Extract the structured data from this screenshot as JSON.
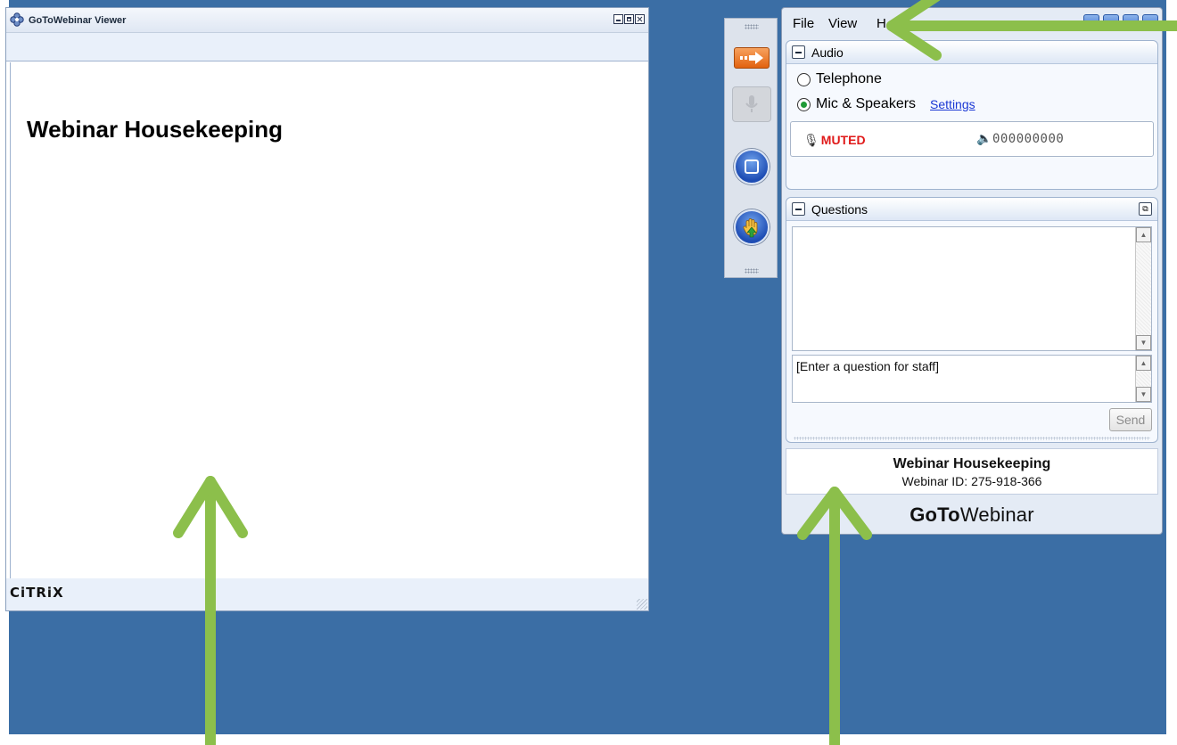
{
  "viewer": {
    "title": "GoToWebinar Viewer",
    "slide_title": "Webinar Housekeeping",
    "footer_logo": "CiTRiX"
  },
  "menu": {
    "file": "File",
    "view": "View",
    "help": "H"
  },
  "audio": {
    "section_title": "Audio",
    "option_telephone": "Telephone",
    "option_mic": "Mic & Speakers",
    "selected": "Mic & Speakers",
    "settings_link": "Settings",
    "status": "MUTED",
    "level_meter": "000000000"
  },
  "questions": {
    "section_title": "Questions",
    "input_placeholder": "[Enter a question for staff]",
    "send_label": "Send"
  },
  "info": {
    "webinar_title": "Webinar Housekeeping",
    "webinar_id": "Webinar ID: 275-918-366"
  },
  "brand": {
    "part_bold": "GoTo",
    "part_regular": "Webinar"
  },
  "colors": {
    "desktop": "#3b6ea5",
    "annotation_arrow": "#8cbf4b",
    "muted": "#e01a1a",
    "link": "#1a37d4"
  }
}
